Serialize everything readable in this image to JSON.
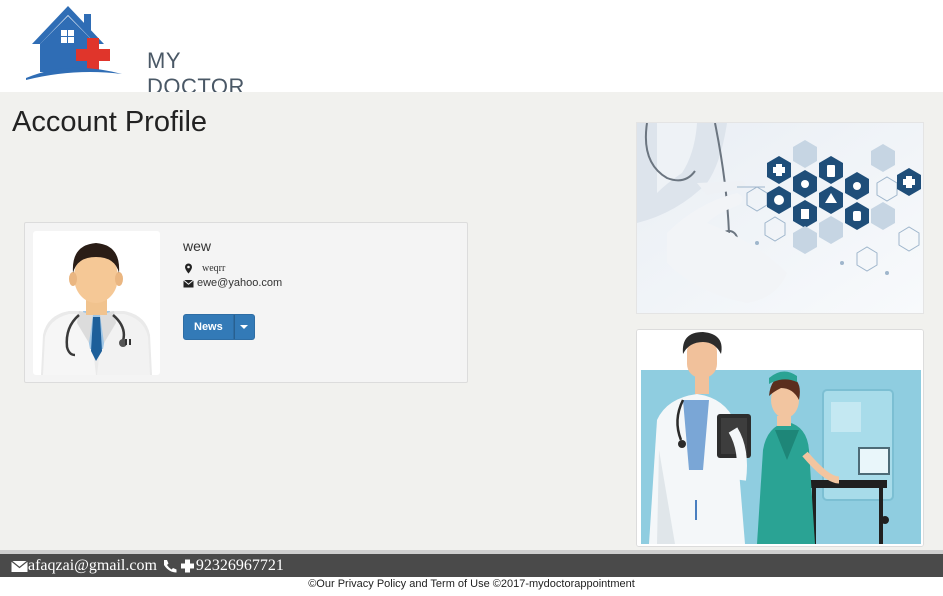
{
  "brand": {
    "name": "MY DOCTOR"
  },
  "page": {
    "title": "Account Profile"
  },
  "profile": {
    "name": "wew",
    "location": "weqrr",
    "email": "ewe@yahoo.com",
    "news_button": "News"
  },
  "footer": {
    "email": "afaqzai@gmail.com",
    "phone": "92326967721",
    "copyright": "©Our Privacy Policy and Term of Use ©2017-mydoctorappointment"
  },
  "icons": {
    "location": "map-marker-icon",
    "email": "envelope-icon",
    "phone": "phone-icon",
    "dropdown": "caret-down-icon"
  },
  "colors": {
    "primary_button": "#337ab7",
    "logo_blue": "#2f6db5",
    "logo_red": "#e0352b",
    "footer_bg": "#4a4a4a",
    "content_bg": "#f1f1ee"
  }
}
